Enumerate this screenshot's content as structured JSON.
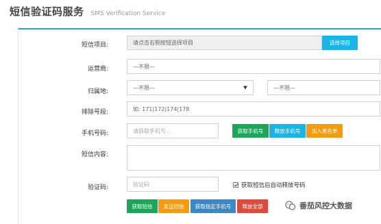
{
  "header": {
    "title": "短信验证码服务",
    "subtitle": "SMS Verification Service"
  },
  "form": {
    "project": {
      "label": "短信项目:",
      "value": "请点击右侧按钮选择项目",
      "button": "选择项目"
    },
    "operator": {
      "label": "运营商:",
      "value": "—不限—"
    },
    "location": {
      "label": "归属地:",
      "province": "—不限—",
      "city": "—不限—"
    },
    "exclude": {
      "label": "排除号段:",
      "placeholder": "如: 171|172|174|178"
    },
    "phone": {
      "label": "手机号码:",
      "placeholder": "请获取手机号...",
      "buttons": [
        "获取手机号",
        "释放手机号",
        "加入黑名单"
      ]
    },
    "content": {
      "label": "短信内容:",
      "value": ""
    },
    "code": {
      "label": "验证码:",
      "placeholder": "验证码",
      "auto_release_label": "获取短信后自动释放号码",
      "auto_release_checked": true
    }
  },
  "actions": {
    "get_sms": "获取短信",
    "send_sms": "发送短信",
    "get_specified": "获取指定手机号",
    "release_all": "释放全部"
  },
  "watermark": {
    "text": "番茄风控大数据"
  },
  "colors": {
    "accent": "#29a3d6",
    "green": "#1aa75a",
    "blue": "#19b5e6",
    "orange": "#f39c12",
    "steel": "#3d87c7",
    "red": "#e04a3c"
  }
}
